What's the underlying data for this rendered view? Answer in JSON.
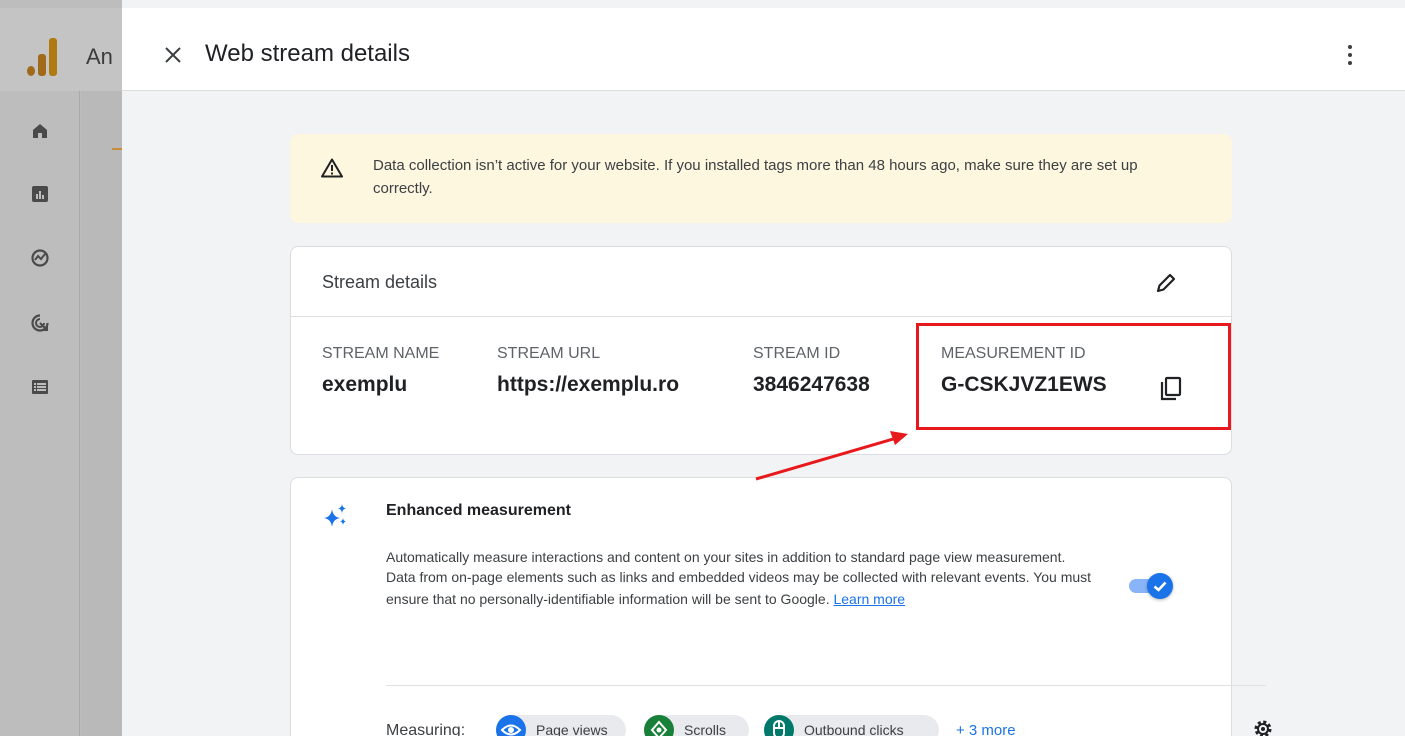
{
  "background_app": {
    "title_fragment": "An"
  },
  "drawer": {
    "title": "Web stream details"
  },
  "banner": {
    "text": "Data collection isn’t active for your website. If you installed tags more than 48 hours ago, make sure they are set up correctly."
  },
  "stream_details": {
    "title": "Stream details",
    "fields": [
      {
        "label": "STREAM NAME",
        "value": "exemplu"
      },
      {
        "label": "STREAM URL",
        "value": "https://exemplu.ro"
      },
      {
        "label": "STREAM ID",
        "value": "3846247638"
      },
      {
        "label": "MEASUREMENT ID",
        "value": "G-CSKJVZ1EWS"
      }
    ]
  },
  "enhanced_measurement": {
    "title": "Enhanced measurement",
    "desc_line1": "Automatically measure interactions and content on your sites in addition to standard page view measurement.",
    "desc_line2": "Data from on-page elements such as links and embedded videos may be collected with relevant events. You must ensure that no personally-identifiable information will be sent to Google.",
    "learn_more": "Learn more",
    "toggle_on": true,
    "measuring_label": "Measuring:",
    "chips": [
      {
        "label": "Page views",
        "icon": "eye-icon",
        "color": "#1a73e8"
      },
      {
        "label": "Scrolls",
        "icon": "scroll-icon",
        "color": "#188038"
      },
      {
        "label": "Outbound clicks",
        "icon": "mouse-icon",
        "color": "#00796b"
      }
    ],
    "more_label": "+ 3 more"
  },
  "colors": {
    "highlight": "#e8191d",
    "banner_bg": "#fef7e0",
    "accent_blue": "#1a73e8",
    "logo_orange": "#e37400",
    "logo_yellow": "#f9ab00"
  }
}
